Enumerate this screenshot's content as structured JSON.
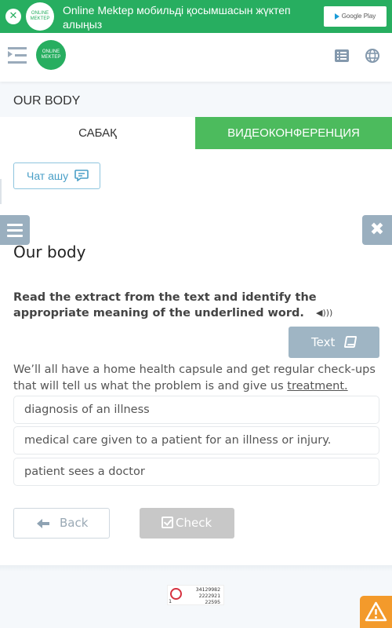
{
  "banner": {
    "close_icon": "close-circle-icon",
    "logo_text_line1": "ONLINE",
    "logo_text_line2": "MEKTEP",
    "message": "Online Mektep мобильді қосымшасын жүктеп алыңыз",
    "store_button_label": "Google Play"
  },
  "header": {
    "menu_icon": "menu-toggle-icon",
    "logo_text_line1": "ONLINE",
    "logo_text_line2": "MEKTEP",
    "icons": [
      "list-icon",
      "globe-icon"
    ]
  },
  "course": {
    "title": "OUR BODY"
  },
  "tabs": [
    {
      "label": "САБАҚ",
      "active": true
    },
    {
      "label": "ВИДЕОКОНФЕРЕНЦИЯ",
      "active": false
    }
  ],
  "chat": {
    "label": "Чат ашу",
    "icon": "chat-icon"
  },
  "lesson": {
    "title": "Our body",
    "question": "Read the extract from the text and identify the appropriate meaning of the underlined word.",
    "text_button_label": "Text",
    "extract_before": "We’ll all have a home health capsule and get regular check-ups that will tell us what the problem is and give us ",
    "extract_underlined": "treatment.",
    "options": [
      {
        "label": "diagnosis of an illness"
      },
      {
        "label": "medical care given to a patient for an illness or injury."
      },
      {
        "label": "patient sees a doctor"
      }
    ],
    "back_label": "Back",
    "check_label": "Check"
  },
  "counter": {
    "left_value": "1",
    "lines": [
      "34129982",
      "2222921",
      "22595"
    ]
  },
  "colors": {
    "brand_green": "#27ae60",
    "tab_green": "#4cbb5d",
    "side_button": "#9aafbf",
    "warning": "#f39a2b",
    "disabled_button": "#c8c8c8"
  }
}
